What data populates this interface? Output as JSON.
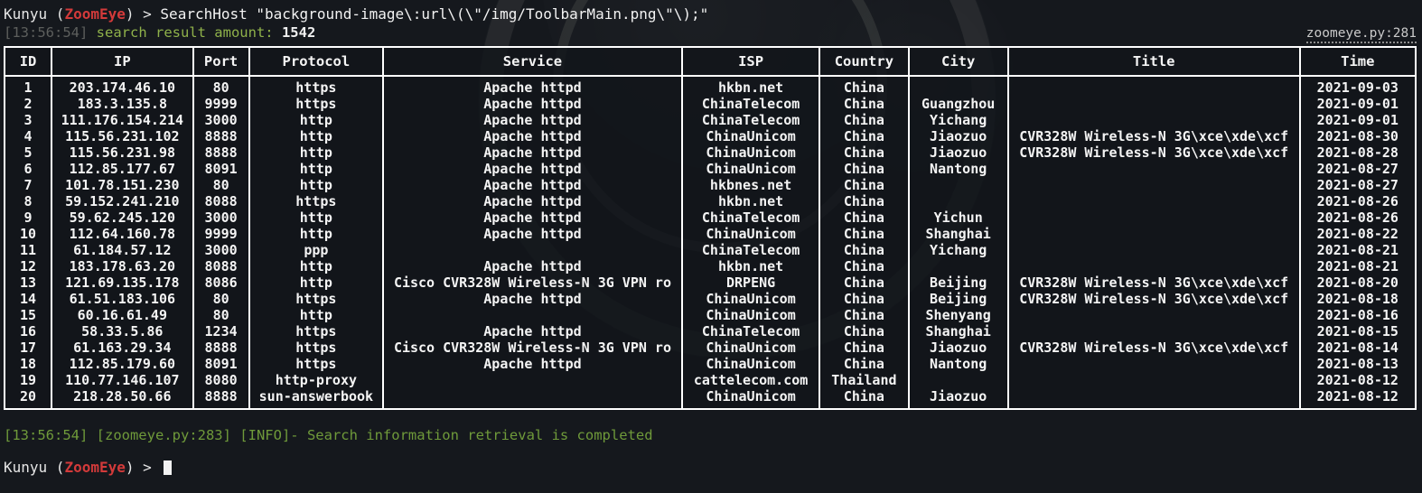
{
  "terminal": {
    "background_color": "#15181d",
    "foreground_color": "#e8e8e8",
    "accent_color": "#d33a3a",
    "log_color": "#6f9a3a",
    "timestamp_color": "#5d5f5d"
  },
  "prompt": {
    "user": "Kunyu ",
    "open_paren": "(",
    "brand": "ZoomEye",
    "close_paren": ")",
    "arrow": " > ",
    "command": "SearchHost \"background-image\\:url\\(\\\"/img/ToolbarMain.png\\\"\\);\""
  },
  "result_summary": {
    "timestamp": "[13:56:54]",
    "message": " search result amount: ",
    "count": "1542"
  },
  "source_ref": "zoomeye.py:281",
  "table": {
    "columns": [
      "ID",
      "IP",
      "Port",
      "Protocol",
      "Service",
      "ISP",
      "Country",
      "City",
      "Title",
      "Time"
    ],
    "rows": [
      [
        "1",
        "203.174.46.10",
        "80",
        "https",
        "Apache httpd",
        "hkbn.net",
        "China",
        "",
        "",
        "2021-09-03"
      ],
      [
        "2",
        "183.3.135.8",
        "9999",
        "https",
        "Apache httpd",
        "ChinaTelecom",
        "China",
        "Guangzhou",
        "",
        "2021-09-01"
      ],
      [
        "3",
        "111.176.154.214",
        "3000",
        "http",
        "Apache httpd",
        "ChinaTelecom",
        "China",
        "Yichang",
        "",
        "2021-09-01"
      ],
      [
        "4",
        "115.56.231.102",
        "8888",
        "http",
        "Apache httpd",
        "ChinaUnicom",
        "China",
        "Jiaozuo",
        "CVR328W Wireless-N 3G\\xce\\xde\\xcf",
        "2021-08-30"
      ],
      [
        "5",
        "115.56.231.98",
        "8888",
        "http",
        "Apache httpd",
        "ChinaUnicom",
        "China",
        "Jiaozuo",
        "CVR328W Wireless-N 3G\\xce\\xde\\xcf",
        "2021-08-28"
      ],
      [
        "6",
        "112.85.177.67",
        "8091",
        "http",
        "Apache httpd",
        "ChinaUnicom",
        "China",
        "Nantong",
        "",
        "2021-08-27"
      ],
      [
        "7",
        "101.78.151.230",
        "80",
        "http",
        "Apache httpd",
        "hkbnes.net",
        "China",
        "",
        "",
        "2021-08-27"
      ],
      [
        "8",
        "59.152.241.210",
        "8088",
        "https",
        "Apache httpd",
        "hkbn.net",
        "China",
        "",
        "",
        "2021-08-26"
      ],
      [
        "9",
        "59.62.245.120",
        "3000",
        "http",
        "Apache httpd",
        "ChinaTelecom",
        "China",
        "Yichun",
        "",
        "2021-08-26"
      ],
      [
        "10",
        "112.64.160.78",
        "9999",
        "http",
        "Apache httpd",
        "ChinaUnicom",
        "China",
        "Shanghai",
        "",
        "2021-08-22"
      ],
      [
        "11",
        "61.184.57.12",
        "3000",
        "ppp",
        "",
        "ChinaTelecom",
        "China",
        "Yichang",
        "",
        "2021-08-21"
      ],
      [
        "12",
        "183.178.63.20",
        "8088",
        "http",
        "Apache httpd",
        "hkbn.net",
        "China",
        "",
        "",
        "2021-08-21"
      ],
      [
        "13",
        "121.69.135.178",
        "8086",
        "http",
        "Cisco CVR328W Wireless-N 3G VPN ro",
        "DRPENG",
        "China",
        "Beijing",
        "CVR328W Wireless-N 3G\\xce\\xde\\xcf",
        "2021-08-20"
      ],
      [
        "14",
        "61.51.183.106",
        "80",
        "https",
        "Apache httpd",
        "ChinaUnicom",
        "China",
        "Beijing",
        "CVR328W Wireless-N 3G\\xce\\xde\\xcf",
        "2021-08-18"
      ],
      [
        "15",
        "60.16.61.49",
        "80",
        "http",
        "",
        "ChinaUnicom",
        "China",
        "Shenyang",
        "",
        "2021-08-16"
      ],
      [
        "16",
        "58.33.5.86",
        "1234",
        "https",
        "Apache httpd",
        "ChinaTelecom",
        "China",
        "Shanghai",
        "",
        "2021-08-15"
      ],
      [
        "17",
        "61.163.29.34",
        "8888",
        "https",
        "Cisco CVR328W Wireless-N 3G VPN ro",
        "ChinaUnicom",
        "China",
        "Jiaozuo",
        "CVR328W Wireless-N 3G\\xce\\xde\\xcf",
        "2021-08-14"
      ],
      [
        "18",
        "112.85.179.60",
        "8091",
        "https",
        "Apache httpd",
        "ChinaUnicom",
        "China",
        "Nantong",
        "",
        "2021-08-13"
      ],
      [
        "19",
        "110.77.146.107",
        "8080",
        "http-proxy",
        "",
        "cattelecom.com",
        "Thailand",
        "",
        "",
        "2021-08-12"
      ],
      [
        "20",
        "218.28.50.66",
        "8888",
        "sun-answerbook",
        "",
        "ChinaUnicom",
        "China",
        "Jiaozuo",
        "",
        "2021-08-12"
      ]
    ]
  },
  "log": {
    "text": "[13:56:54] [zoomeye.py:283] [INFO]- Search information retrieval is completed"
  },
  "prompt_bottom": {
    "user": "Kunyu ",
    "open_paren": "(",
    "brand": "ZoomEye",
    "close_paren": ")",
    "arrow": " > "
  }
}
